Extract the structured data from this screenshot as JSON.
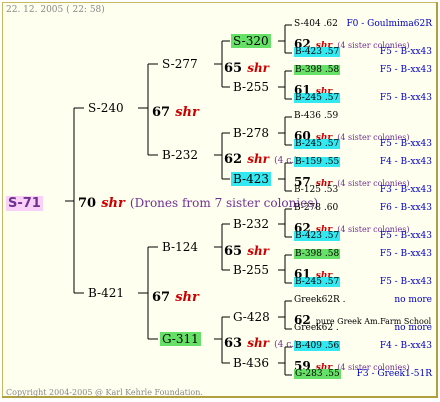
{
  "header": {
    "date_text": "22. 12. 2005 ( 22: 58)"
  },
  "footer": {
    "copyright": "Copyright 2004-2005 @ Karl Kehrle Foundation."
  },
  "root": {
    "id": "S-71",
    "gen_num": "70",
    "shr": "shr",
    "note": "(Drones from 7 sister colonies)"
  },
  "gen1": [
    {
      "id": "S-240",
      "num": "67",
      "shr": "shr"
    },
    {
      "id": "B-421",
      "num": "67",
      "shr": "shr"
    }
  ],
  "gen2": [
    {
      "id": "S-277",
      "num": "65",
      "shr": "shr"
    },
    {
      "id": "B-232",
      "num": "62",
      "shr": "shr",
      "note": "(4 c.)"
    },
    {
      "id": "B-124",
      "num": "65",
      "shr": "shr"
    },
    {
      "id": "G-311",
      "num": "63",
      "shr": "shr",
      "note": "(4 c.)"
    }
  ],
  "gen3": [
    {
      "id": "S-320"
    },
    {
      "id": "B-255"
    },
    {
      "id": "B-278"
    },
    {
      "id": "B-423"
    },
    {
      "id": "B-232"
    },
    {
      "id": "B-255"
    },
    {
      "id": "G-428"
    },
    {
      "id": "B-436"
    }
  ],
  "gen4": [
    {
      "l1": "S-404 .62",
      "l2": "62",
      "l2_shr": "shr",
      "l2_note": "(4 sister colonies)",
      "l3": "B-423 .57",
      "r1": "F0 - Goulmima62R",
      "r3": "F5 - B-xx43"
    },
    {
      "l1": "B-398 .58",
      "l2": "61",
      "l2_shr": "shr",
      "l3": "B-245 .57",
      "r1": "F5 - B-xx43",
      "r3": "F5 - B-xx43"
    },
    {
      "l1": "B-436 .59",
      "l2": "60",
      "l2_shr": "shr",
      "l2_note": "(4 sister colonies)",
      "l3": "B-245 .57",
      "r1": "",
      "r3": "F5 - B-xx43"
    },
    {
      "l1": "B-159 .55",
      "l2": "57",
      "l2_shr": "shr",
      "l2_note": "(4 sister colonies)",
      "l3": "B-125 .53",
      "r1": "F4 - B-xx43",
      "r3": "F3 - B-xx43"
    },
    {
      "l1": "B-278 .60",
      "l2": "62",
      "l2_shr": "shr",
      "l2_note": "(4 sister colonies)",
      "l3": "B-423 .57",
      "r1": "F6 - B-xx43",
      "r3": "F5 - B-xx43"
    },
    {
      "l1": "B-398 .58",
      "l2": "61",
      "l2_shr": "shr",
      "l3": "B-245 .57",
      "r1": "F5 - B-xx43",
      "r3": "F5 - B-xx43"
    },
    {
      "l1": "Greek62R .",
      "l2": "62",
      "l2_text": "pure Greek Am.Farm School",
      "l3": "Greek62 .",
      "r1": "no more",
      "r3": "no more"
    },
    {
      "l1": "B-409 .56",
      "l2": "59",
      "l2_shr": "shr",
      "l2_note": "(4 sister colonies)",
      "l3": "G-283 .55",
      "r1": "F4 - B-xx43",
      "r3": "F3 - Greek1-51R"
    }
  ]
}
